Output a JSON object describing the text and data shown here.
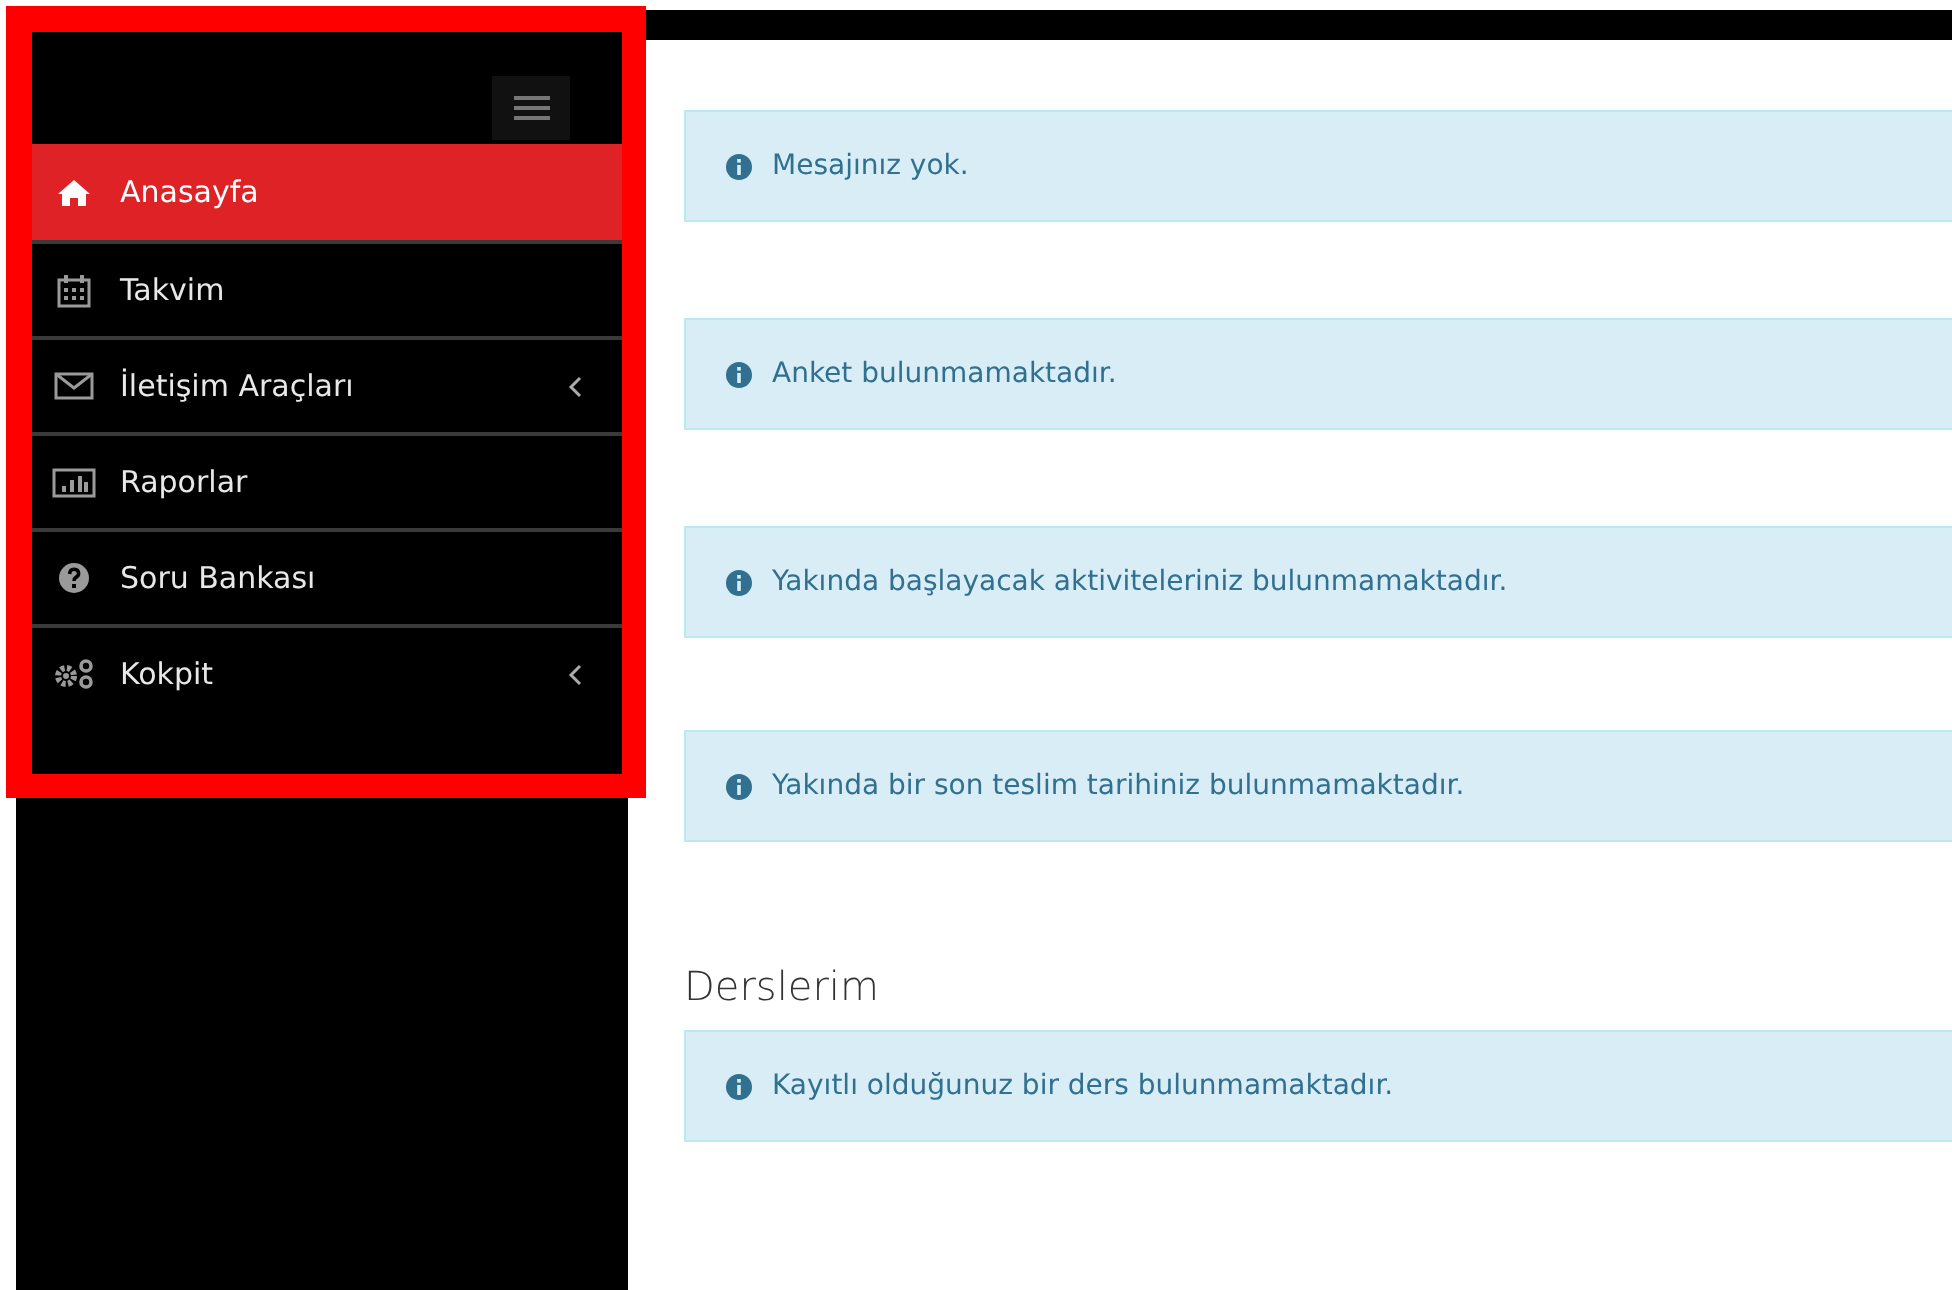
{
  "sidebar": {
    "items": [
      {
        "label": "Anasayfa",
        "selected": true,
        "kind": "link"
      },
      {
        "label": "Takvim",
        "selected": false,
        "kind": "link"
      },
      {
        "label": "İletişim Araçları",
        "selected": false,
        "kind": "submenu"
      },
      {
        "label": "Raporlar",
        "selected": false,
        "kind": "link"
      },
      {
        "label": "Soru Bankası",
        "selected": false,
        "kind": "link"
      },
      {
        "label": "Kokpit",
        "selected": false,
        "kind": "submenu"
      }
    ]
  },
  "alerts": [
    {
      "text": "Mesajınız yok."
    },
    {
      "text": "Anket bulunmamaktadır."
    },
    {
      "text": "Yakında başlayacak aktiviteleriniz bulunmamaktadır."
    },
    {
      "text": "Yakında bir son teslim tarihiniz bulunmamaktadır."
    }
  ],
  "courses": {
    "heading": "Derslerim",
    "alerts": [
      {
        "text": "Kayıtlı olduğunuz bir ders bulunmamaktadır."
      }
    ]
  }
}
